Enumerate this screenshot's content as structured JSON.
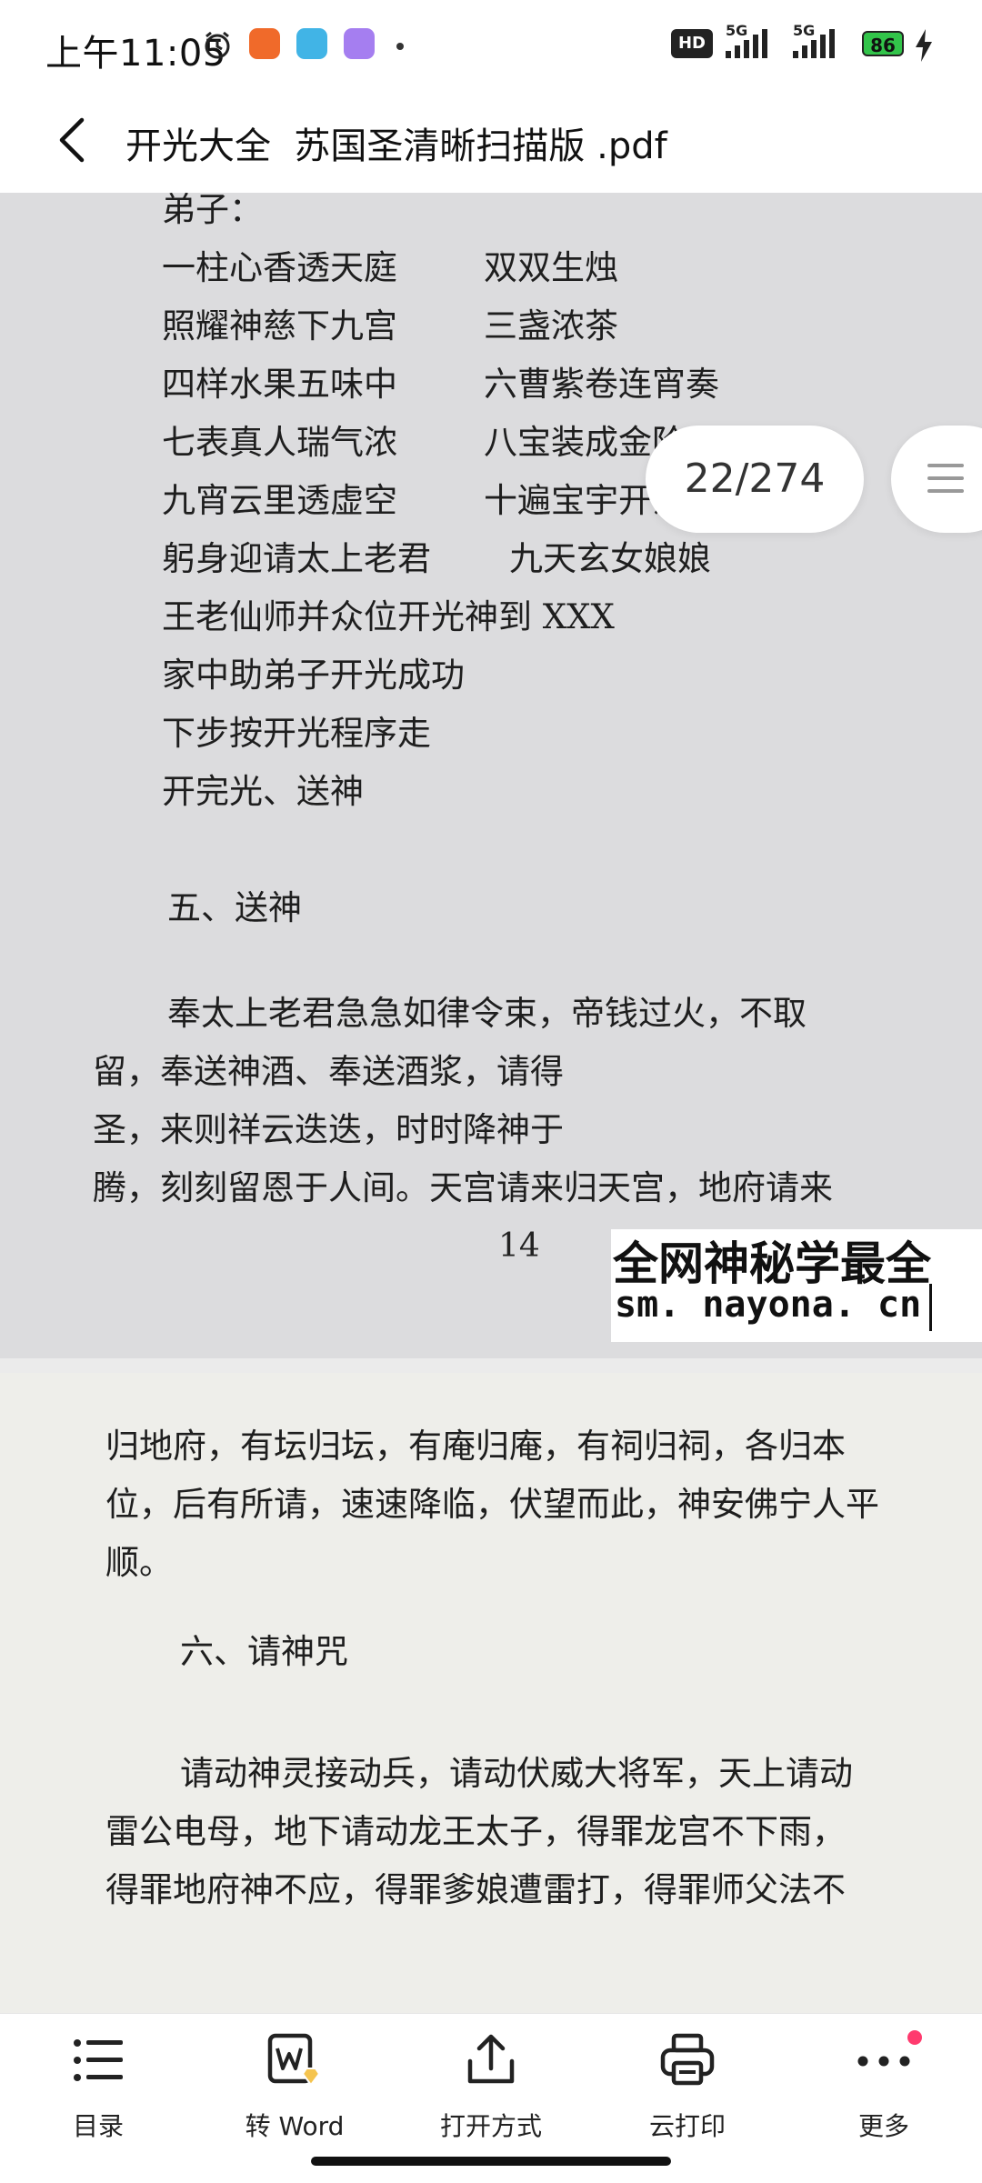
{
  "status_bar": {
    "time": "上午11:05",
    "hd_badge": "HD",
    "network_1": "5G",
    "network_2": "5G",
    "battery": "86",
    "colors": {
      "battery": "#32c44a",
      "app1": "#f06a2a",
      "app2": "#41b4e6",
      "app3": "#a57ef0"
    }
  },
  "title_bar": {
    "title": "开光大全  苏国圣清晰扫描版 .pdf"
  },
  "page_indicator": "22/274",
  "document": {
    "page_1_lines": [
      "弟子：",
      "一柱心香透天庭",
      "双双生烛",
      "照耀神慈下九宫",
      "三盏浓茶",
      "四样水果五味中",
      "六曹紫卷连宵奏",
      "七表真人瑞气浓",
      "八宝装成金阶殿",
      "九宵云里透虚空",
      "十遍宝宇开法界",
      "躬身迎请太上老君",
      "九天玄女娘娘",
      "王老仙师并众位开光神到 XXX",
      "家中助弟子开光成功",
      "下步按开光程序走",
      "开完光、送神",
      "五、送神",
      "奉太上老君急急如律令束，帝钱过火，不取",
      "留，奉送神酒、奉送酒浆，请得",
      "圣，来则祥云迭迭，时时降神于",
      "腾，刻刻留恩于人间。天宫请来归天宫，地府请来"
    ],
    "page_1_number": "14",
    "page_2_lines": [
      "归地府，有坛归坛，有庵归庵，有祠归祠，各归本",
      "位，后有所请，速速降临，伏望而此，神安佛宁人平",
      "顺。",
      "六、请神咒",
      "请动神灵接动兵，请动伏威大将军，天上请动",
      "雷公电母，地下请动龙王太子，得罪龙宫不下雨，",
      "得罪地府神不应，得罪爹娘遭雷打，得罪师父法不"
    ]
  },
  "watermark": {
    "line1": "全网神秘学最全",
    "line2": "sm. nayona. cn"
  },
  "toolbar": {
    "items": [
      {
        "label": "目录",
        "icon": "list-icon"
      },
      {
        "label": "转 Word",
        "icon": "word-convert-icon"
      },
      {
        "label": "打开方式",
        "icon": "share-icon"
      },
      {
        "label": "云打印",
        "icon": "printer-icon"
      },
      {
        "label": "更多",
        "icon": "more-icon"
      }
    ],
    "badge_color": "#ff3a6e"
  }
}
